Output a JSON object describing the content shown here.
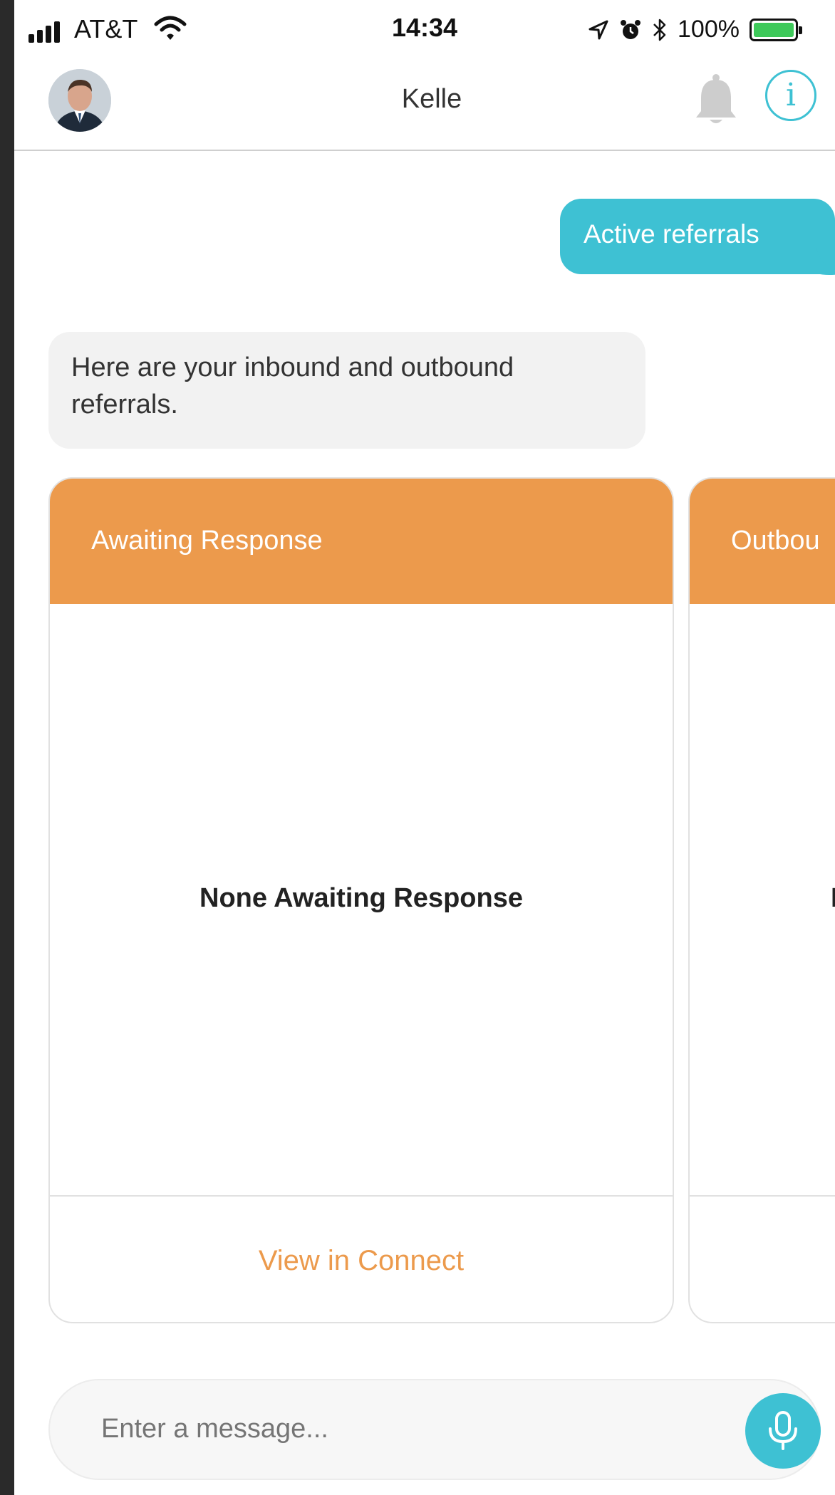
{
  "status_bar": {
    "carrier": "AT&T",
    "time": "14:34",
    "battery": "100%",
    "battery_level": 1.0,
    "icons": [
      "signal-icon",
      "wifi-icon",
      "location-arrow-icon",
      "alarm-icon",
      "bluetooth-icon",
      "battery-icon"
    ]
  },
  "nav": {
    "title": "Kelle",
    "icons": [
      "avatar",
      "bell-icon",
      "info-icon"
    ],
    "info_glyph": "i"
  },
  "chat": {
    "user_message": "Active referrals",
    "bot_message": "Here are your inbound and outbound referrals."
  },
  "cards": [
    {
      "header": "Awaiting Response",
      "empty_text": "None Awaiting Response",
      "link": "View in Connect"
    },
    {
      "header": "Outbou",
      "empty_text": "I",
      "link": ""
    }
  ],
  "composer": {
    "placeholder": "Enter a message..."
  },
  "colors": {
    "accent_teal": "#3ec1d3",
    "card_orange": "#ec9a4c",
    "bubble_gray": "#f2f2f2",
    "battery_green": "#3ec95a"
  }
}
